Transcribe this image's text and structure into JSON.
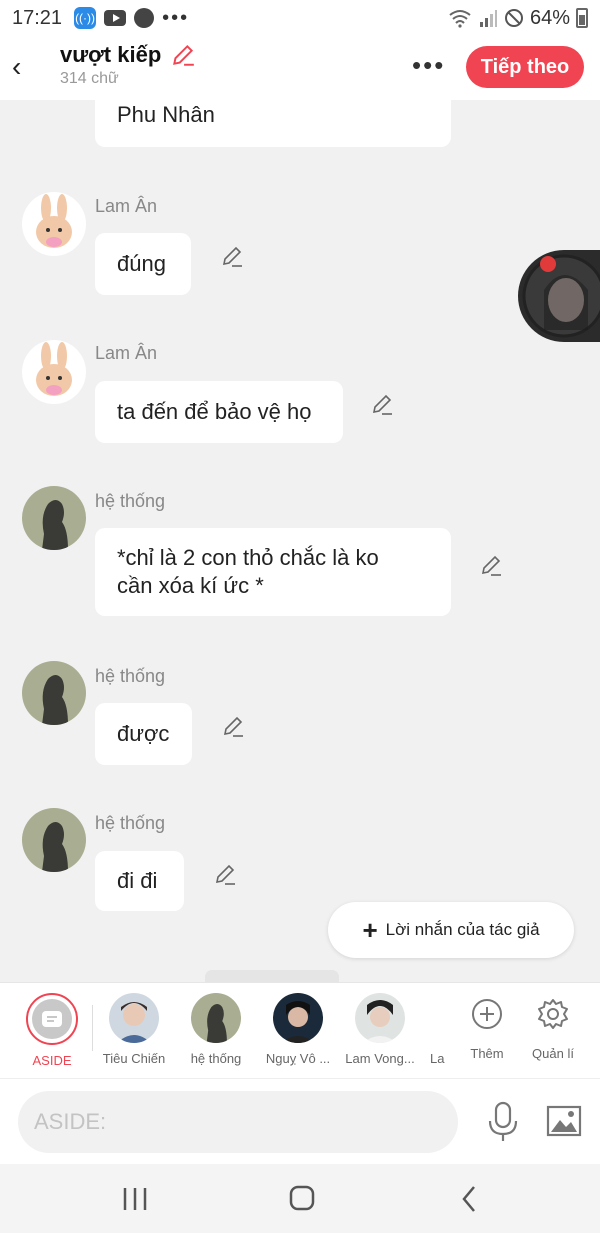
{
  "status_bar": {
    "time": "17:21",
    "battery": "64%",
    "dots": "•••"
  },
  "header": {
    "back_glyph": "‹",
    "title": "vượt kiếp",
    "subtitle": "314 chữ",
    "more_glyph": "•••",
    "next_button": "Tiếp theo"
  },
  "colors": {
    "accent": "#f04452",
    "background": "#f1f1f1",
    "bubble": "#ffffff"
  },
  "messages": [
    {
      "text": "Phu Nhân"
    },
    {
      "sender": "Lam Ân",
      "text": "đúng"
    },
    {
      "sender": "Lam Ân",
      "text": "ta đến để bảo vệ họ"
    },
    {
      "sender": "hệ thống",
      "line1": "*chỉ là 2 con thỏ chắc là ko",
      "line2": "cần xóa kí ức *"
    },
    {
      "sender": "hệ thống",
      "text": "được"
    },
    {
      "sender": "hệ thống",
      "text": "đi đi"
    }
  ],
  "author_note_button": {
    "plus": "+",
    "label": "Lời nhắn của tác giả"
  },
  "characters": [
    {
      "name": "ASIDE"
    },
    {
      "name": "Tiêu Chiến"
    },
    {
      "name": "hệ thống"
    },
    {
      "name": "Nguỵ Vô ..."
    },
    {
      "name": "Lam Vong..."
    },
    {
      "name": "La"
    }
  ],
  "tools": {
    "add": "Thêm",
    "manage": "Quản lí"
  },
  "input": {
    "placeholder": "ASIDE:"
  },
  "icons": [
    "back-icon",
    "edit-pencil-icon",
    "more-icon",
    "mic-icon",
    "image-icon",
    "add-icon",
    "gear-icon",
    "recent-apps-icon",
    "home-icon",
    "nav-back-icon"
  ]
}
